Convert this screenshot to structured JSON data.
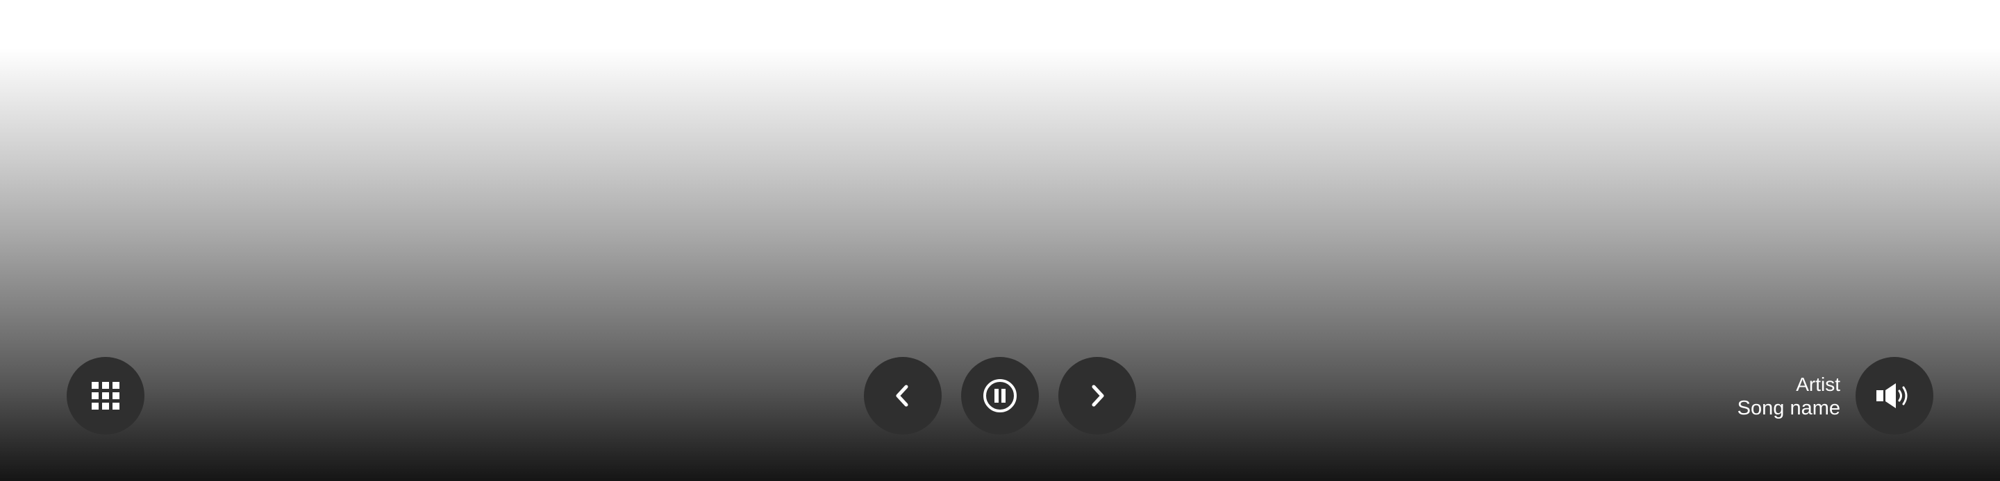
{
  "player": {
    "apps_button": {
      "icon": "grid-icon"
    },
    "prev_button": {
      "icon": "chevron-left-icon"
    },
    "pause_button": {
      "icon": "pause-circle-icon"
    },
    "next_button": {
      "icon": "chevron-right-icon"
    },
    "volume_button": {
      "icon": "speaker-icon"
    },
    "now_playing": {
      "artist": "Artist",
      "song": "Song name"
    }
  },
  "colors": {
    "button_bg": "#2f2f2f",
    "icon": "#ffffff",
    "text": "#ffffff"
  }
}
